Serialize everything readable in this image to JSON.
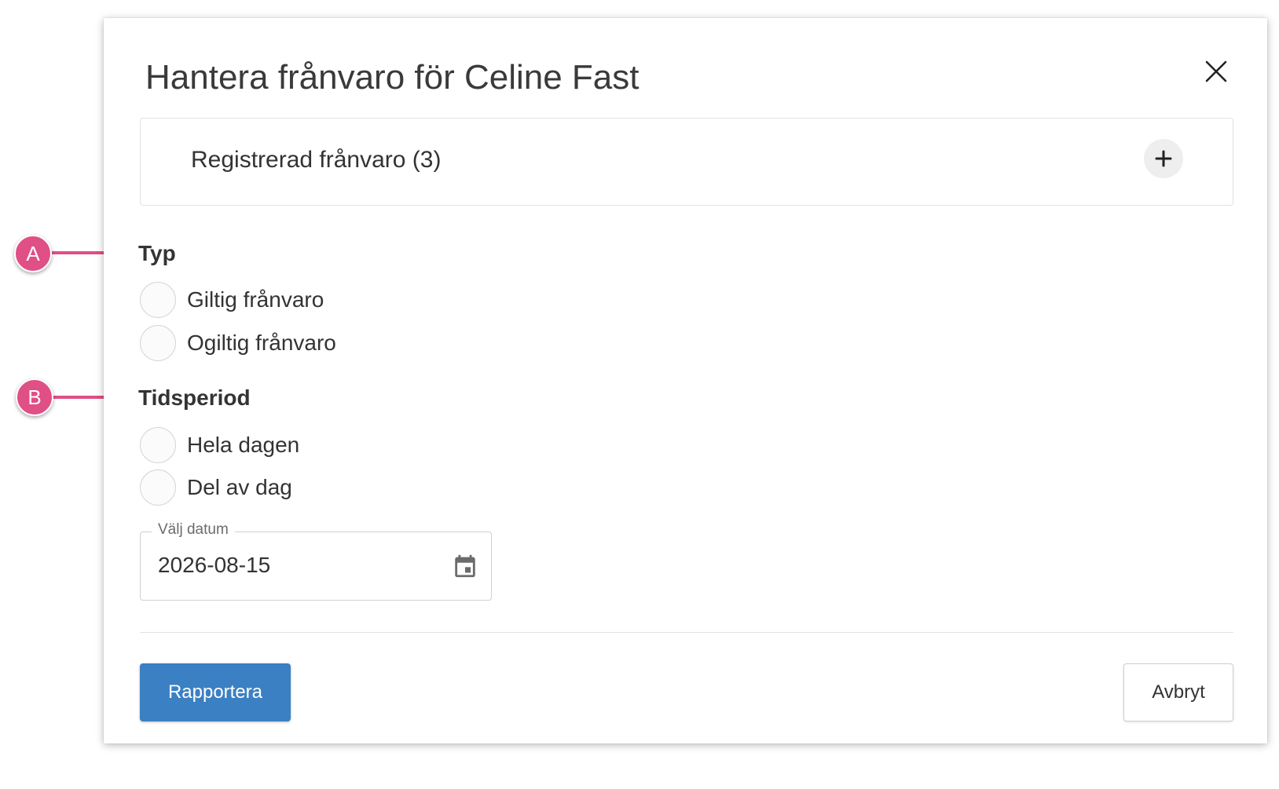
{
  "dialog": {
    "title": "Hantera frånvaro för Celine Fast",
    "close_icon": "close-icon"
  },
  "accordion": {
    "label": "Registrerad frånvaro (3)",
    "expand_icon": "plus-icon"
  },
  "type_section": {
    "label": "Typ",
    "options": [
      {
        "label": "Giltig frånvaro",
        "selected": false
      },
      {
        "label": "Ogiltig frånvaro",
        "selected": false
      }
    ]
  },
  "period_section": {
    "label": "Tidsperiod",
    "options": [
      {
        "label": "Hela dagen",
        "selected": false
      },
      {
        "label": "Del av dag",
        "selected": false
      }
    ]
  },
  "date_field": {
    "legend": "Välj datum",
    "value": "2026-08-15",
    "icon": "calendar-icon"
  },
  "footer": {
    "submit_label": "Rapportera",
    "cancel_label": "Avbryt"
  },
  "callouts": {
    "a": "A",
    "b": "B"
  },
  "colors": {
    "primary": "#3b80c2",
    "callout": "#e04f86"
  }
}
